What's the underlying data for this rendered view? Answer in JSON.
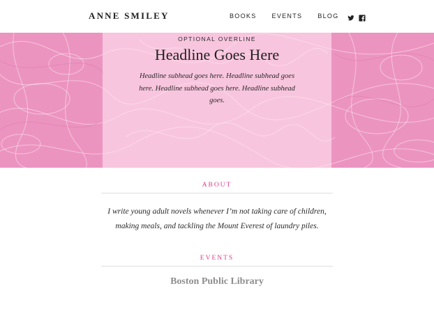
{
  "header": {
    "brand": "ANNE SMILEY",
    "nav": [
      {
        "label": "BOOKS"
      },
      {
        "label": "EVENTS"
      },
      {
        "label": "BLOG"
      }
    ],
    "social_icons": [
      "twitter-icon",
      "facebook-icon"
    ]
  },
  "hero": {
    "overline": "OPTIONAL OVERLINE",
    "headline": "Headline Goes Here",
    "subhead": "Headline subhead goes here. Headline subhead goes here. Headline subhead goes here. Headline subhead goes."
  },
  "about": {
    "title": "ABOUT",
    "text": "I write young adult novels whenever I’m not taking care of children, making meals, and tackling the Mount Everest of laundry piles."
  },
  "events": {
    "title": "EVENTS",
    "items": [
      {
        "name": "Boston Public Library"
      }
    ]
  },
  "colors": {
    "accent": "#e0398b",
    "hero_pink": "#ea8fbb",
    "panel_tint": "#ffe4f0",
    "divider": "#dedede"
  }
}
